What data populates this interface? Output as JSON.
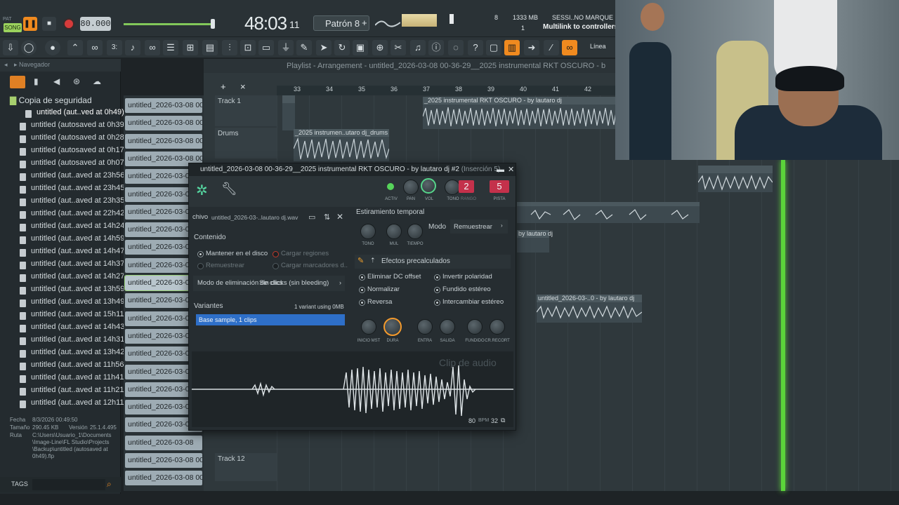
{
  "topbar": {
    "pat_label": "PAT",
    "song_label": "SONG",
    "tempo": "80.000",
    "time_main": "48:03",
    "time_sub": "11",
    "pattern": "Patrón 8",
    "cpu_value": "8",
    "ram": "1333 MB",
    "poly": "1",
    "hint_line1": "SESSI..NO MARQUE",
    "hint_line2": "Multilink to controllers",
    "snap_label": "Línea"
  },
  "browser": {
    "title": "Navegador",
    "folder": "Copia de seguridad",
    "items": [
      "untitled (aut..ved at 0h49)",
      "untitled (autosaved at 0h39)",
      "untitled (autosaved at 0h28)",
      "untitled (autosaved at 0h17)",
      "untitled (autosaved at 0h07)",
      "untitled (aut..aved at 23h56)",
      "untitled (aut..aved at 23h45)",
      "untitled (aut..aved at 23h35)",
      "untitled (aut..aved at 22h42)",
      "untitled (aut..aved at 14h24)",
      "untitled (aut..aved at 14h59)",
      "untitled (aut..aved at 14h47)",
      "untitled (aut..aved at 14h37)",
      "untitled (aut..aved at 14h27)",
      "untitled (aut..aved at 13h59)",
      "untitled (aut..aved at 13h49)",
      "untitled (aut..aved at 15h11)",
      "untitled (aut..aved at 14h43)",
      "untitled (aut..aved at 14h31)",
      "untitled (aut..aved at 13h42)",
      "untitled (aut..aved at 11h56)",
      "untitled (aut..aved at 11h41)",
      "untitled (aut..aved at 11h21)",
      "untitled (aut..aved at 12h11)"
    ],
    "info": {
      "fecha_label": "Fecha",
      "fecha": "8/3/2026 00:49:50",
      "tamano_label": "Tamaño",
      "tamano": "290.45 KB",
      "version_label": "Versión",
      "version": "25.1.4.495",
      "ruta_label": "Ruta",
      "ruta": "C:\\Users\\Usuario_1\\Documents\\Image-Line\\FL Studio\\Projects\\Backup\\untitled (autosaved at 0h49).flp"
    },
    "tags_label": "TAGS"
  },
  "channels": [
    "untitled_2026-03-08 00-...",
    "untitled_2026-03-08 00-...",
    "untitled_2026-03-08 00-...",
    "untitled_2026-03-08 00-...",
    "untitled_2026-03-08",
    "untitled_2026-03-08",
    "untitled_2026-03-08",
    "untitled_2026-03-08",
    "untitled_2026-03-08",
    "untitled_2026-03-08",
    "untitled_2026-03-08",
    "untitled_2026-03-08",
    "untitled_2026-03-08",
    "untitled_2026-03-08",
    "untitled_2026-03-08",
    "untitled_2026-03-08",
    "untitled_2026-03-08",
    "untitled_2026-03-08",
    "untitled_2026-03-08",
    "untitled_2026-03-08",
    "untitled_2026-03-08 00-...",
    "untitled_2026-03-08 00-..."
  ],
  "playlist": {
    "title": "Playlist - Arrangement",
    "file": "untitled_2026-03-08 00-36-29__2025 instrumental RKT OSCURO - b",
    "ruler": [
      "33",
      "34",
      "35",
      "36",
      "37",
      "38",
      "39",
      "40",
      "41",
      "42"
    ],
    "tracks": [
      "Track 1",
      "Drums",
      "Track 12"
    ],
    "clips": [
      "_2025 instrumental RKT OSCURO - by lautaro dj",
      "_2025 instrumen..utaro dj_drums",
      "by lautaro dj",
      "untitled_2026-03-..0 - by lautaro dj"
    ]
  },
  "sampler": {
    "title": "untitled_2026-03-08 00-36-29__2025 instrumental RKT OSCURO - by lautaro dj #2",
    "insert": "(Inserción 5)",
    "top_knobs": [
      "ACTIV",
      "PAN",
      "VOL",
      "TONO",
      "RANGO"
    ],
    "pitch_value": "2",
    "track_value": "5",
    "track_label": "PISTA",
    "file_label": "chivo",
    "file_name": "untitled_2026-03-..lautaro dj.wav",
    "contenido_label": "Contenido",
    "mantener": "Mantener en el disco",
    "cargar_regiones": "Cargar regiones",
    "remuestrear_opt": "Remuestrear",
    "cargar_marcadores": "Cargar marcadores d..",
    "click_mode_label": "Modo de eliminación de clics",
    "click_mode_value": "Sin clicks (sin bleeding)",
    "variantes_label": "Variantes",
    "variant_info": "1 variant using 0MB",
    "variant_item": "Base sample, 1 clips",
    "stretch_label": "Estiramiento temporal",
    "stretch_knobs": [
      "TONO",
      "MUL",
      "TIEMPO"
    ],
    "mode_label": "Modo",
    "mode_value": "Remuestrear",
    "precalc_label": "Efectos precalculados",
    "effects_left": [
      "Eliminar DC offset",
      "Normalizar",
      "Reversa"
    ],
    "effects_right": [
      "Invertir polaridad",
      "Fundido estéreo",
      "Intercambiar estéreo"
    ],
    "bottom_knobs": [
      "INICIO MST",
      "DURA",
      "ENTRA",
      "SALIDA",
      "FUNDIDO",
      "CR.RECORT"
    ],
    "clip_label": "Clip de audio",
    "bpm": "80",
    "bpm_label": "BPM",
    "beats": "32"
  }
}
